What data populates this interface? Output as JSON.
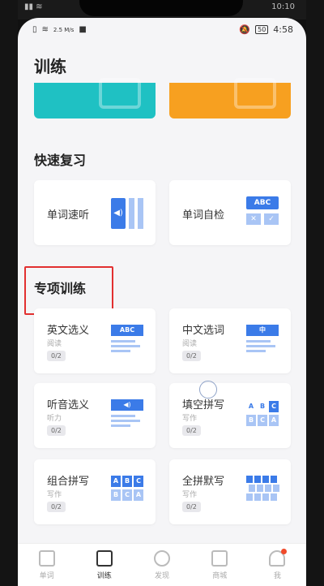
{
  "device_status": {
    "carrier_icons": "📶",
    "time": "10:10"
  },
  "status": {
    "left_text": "2.5 M/s",
    "battery": "50",
    "time": "4:58"
  },
  "page": {
    "title": "训练"
  },
  "quick_review": {
    "title": "快速复习",
    "items": [
      {
        "label": "单词速听",
        "icon": "speaker-bars-icon"
      },
      {
        "label": "单词自检",
        "icon": "abc-check-icon",
        "abc": "ABC"
      }
    ]
  },
  "special": {
    "title": "专项训练",
    "items": [
      {
        "label": "英文选义",
        "sub": "阅读",
        "badge": "0/2",
        "icon_text": "ABC"
      },
      {
        "label": "中文选词",
        "sub": "阅读",
        "badge": "0/2",
        "icon_text": "中"
      },
      {
        "label": "听音选义",
        "sub": "听力",
        "badge": "0/2"
      },
      {
        "label": "填空拼写",
        "sub": "写作",
        "badge": "0/2",
        "letters": [
          "A",
          "B",
          "C",
          "B",
          "C",
          "A"
        ]
      },
      {
        "label": "组合拼写",
        "sub": "写作",
        "badge": "0/2",
        "letters": [
          "A",
          "B",
          "C",
          "B",
          "C",
          "A"
        ]
      },
      {
        "label": "全拼默写",
        "sub": "写作",
        "badge": "0/2"
      }
    ]
  },
  "tabs": [
    {
      "label": "单词",
      "icon": "book-icon"
    },
    {
      "label": "训练",
      "icon": "edit-icon",
      "active": true
    },
    {
      "label": "发现",
      "icon": "compass-icon"
    },
    {
      "label": "商城",
      "icon": "store-icon"
    },
    {
      "label": "我",
      "icon": "person-icon",
      "notification": true
    }
  ]
}
